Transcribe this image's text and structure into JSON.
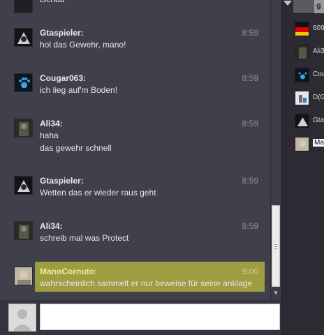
{
  "chat": {
    "partial_top_line": "tschau",
    "messages": [
      {
        "user": "Gtaspieler:",
        "time": "8:59",
        "lines": [
          "hol das Gewehr, mano!"
        ]
      },
      {
        "user": "Cougar063:",
        "time": "8:59",
        "lines": [
          "ich lieg auf'm Boden!"
        ]
      },
      {
        "user": "Ali34:",
        "time": "8:59",
        "lines": [
          "haha",
          "das gewehr schnell"
        ]
      },
      {
        "user": "Gtaspieler:",
        "time": "8:59",
        "lines": [
          "Wetten das er wieder raus geht"
        ]
      },
      {
        "user": "Ali34:",
        "time": "8:59",
        "lines": [
          "schreib mal was Protect"
        ]
      },
      {
        "user": "ManoCornuto:",
        "time": "9:00",
        "lines": [
          "wahrscheinlich sammelt er nur beweise für seine anklage"
        ],
        "highlighted": true
      }
    ]
  },
  "compose": {
    "placeholder": "",
    "value": ""
  },
  "sidebar": {
    "top_badge": "g",
    "members": [
      {
        "name": "609"
      },
      {
        "name": "Ali3"
      },
      {
        "name": "Cou"
      },
      {
        "name": "D(G"
      },
      {
        "name": "Gtas"
      },
      {
        "name": "Man",
        "selected": true
      }
    ]
  },
  "colors": {
    "chat_bg": "#403f4c",
    "highlight": "#9f9d42",
    "highlight_name": "#f0ec9c",
    "sidebar_bg": "#2c2b33"
  }
}
